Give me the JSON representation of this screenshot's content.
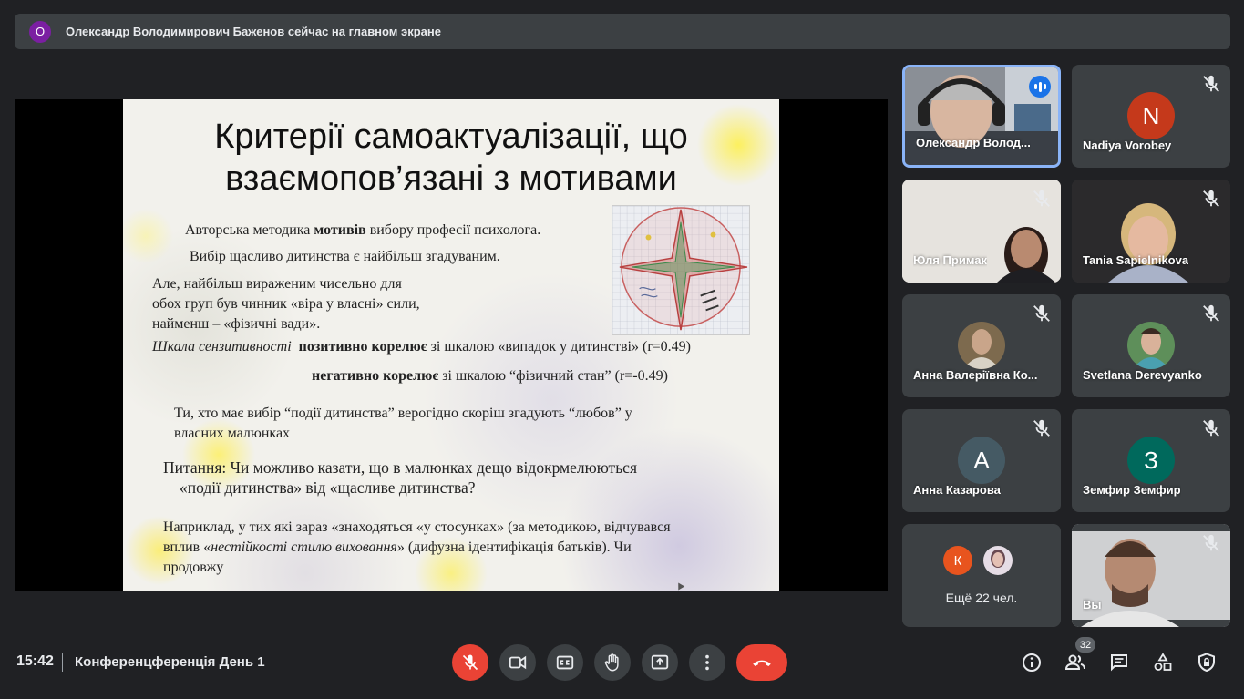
{
  "banner": {
    "avatar_letter": "О",
    "text": "Олександр Володимирович Баженов сейчас на главном экране"
  },
  "slide": {
    "title_line1": "Критерії самоактуалізації, що",
    "title_line2": "взаємопов’язані з мотивами",
    "p1_pre": "Авторська методика ",
    "p1_bold": "мотивів",
    "p1_post": " вибору професії психолога.",
    "p2": "Вибір щасливо дитинства є найбільш згадуваним.",
    "p3_l1": "Але, найбільш вираженим чисельно для",
    "p3_l2": "обох груп був чинник «віра у власні» сили,",
    "p3_l3": "найменш – «фізичні вади».",
    "p4_italic": "Шкала сензитивності",
    "p4_bold": "позитивно корелює",
    "p4_post": " зі шкалою «випадок у дитинстві» (r=0.49)",
    "p5_bold": "негативно корелює",
    "p5_post": " зі шкалою “фізичний стан” (r=-0.49)",
    "p6_l1": "Ти, хто має вибір “події дитинства” верогідно скоріш згадують “любов” у",
    "p6_l2": "власних малюнках",
    "p7_l1": "Питання: Чи можливо казати, що в малюнках дещо відокрмелюються",
    "p7_l2": "«події дитинства» від «щасливе дитинства?",
    "p8_l1": "Наприклад, у тих які зараз «знаходяться «у стосунках» (за методикою, відчувався",
    "p8_l2_pre": "вплив «",
    "p8_l2_italic": "нестійкості стилю виховання",
    "p8_l2_post": "» (дифузна ідентифікація батьків).  Чи",
    "p8_l3": "продовжу"
  },
  "participants": [
    {
      "name": "Олександр Волод...",
      "type": "video",
      "active": true
    },
    {
      "name": "Nadiya Vorobey",
      "type": "avatar",
      "letter": "N",
      "color": "#c5391b"
    },
    {
      "name": "Юля Примак",
      "type": "video"
    },
    {
      "name": "Tania Sapielnikova",
      "type": "video"
    },
    {
      "name": "Анна Валеріївна Ко...",
      "type": "photo"
    },
    {
      "name": "Svetlana Derevyanko",
      "type": "photo"
    },
    {
      "name": "Анна Казарова",
      "type": "avatar",
      "letter": "А",
      "color": "#455a64"
    },
    {
      "name": "Земфир Земфир",
      "type": "avatar",
      "letter": "З",
      "color": "#00695c"
    },
    {
      "name": "Вы",
      "type": "video"
    }
  ],
  "more": {
    "letter": "К",
    "letter_color": "#e8541e",
    "text": "Ещё 22 чел."
  },
  "footer": {
    "time": "15:42",
    "meeting": "Конференцференція День 1",
    "participant_count": "32",
    "colors": {
      "leave": "#ea4335",
      "mic_off": "#ea4335",
      "control_bg": "#3c4043"
    }
  }
}
